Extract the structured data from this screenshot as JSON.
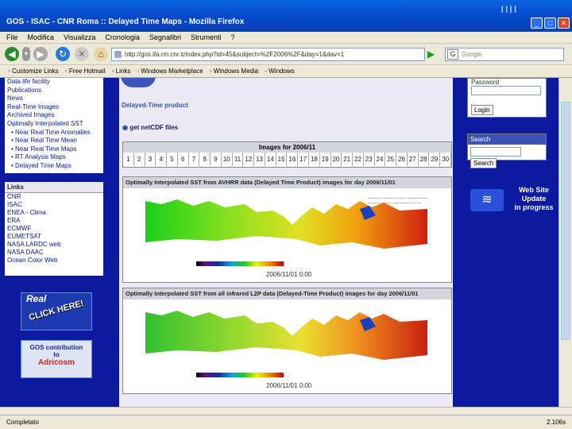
{
  "window": {
    "title": "GOS - ISAC - CNR Roma :: Delayed Time Maps - Mozilla Firefox",
    "deco": "ıııı"
  },
  "menu": [
    "File",
    "Modifica",
    "Visualizza",
    "Cronologia",
    "Segnalibri",
    "Strumenti",
    "?"
  ],
  "address": {
    "url": "http://gos.ifa.rm.cnr.it/index.php?id=45&subject=%2F2006%2F&day=1&dav=1"
  },
  "search": {
    "placeholder": "Google",
    "engine_letter": "G"
  },
  "bookmarks": [
    "Customize Links",
    "Free Hotmail",
    "Links",
    "Windows Marketplace",
    "Windows Media",
    "Windows"
  ],
  "left_nav": {
    "items": [
      "Data life facility",
      "Publications",
      "News",
      "Real-Time Images",
      "Archived Images",
      "Optimally Interpolated SST"
    ],
    "sub_items": [
      "Near Real Time Anomalies",
      "Near Real Time Mean",
      "Near Real Time Maps",
      "RT Analysis Maps",
      "Delayed Time Maps"
    ]
  },
  "links": {
    "header": "Links",
    "items": [
      "CNR",
      "ISAC",
      "ENEA - Clima",
      "ERA",
      "ECMWF",
      "EUMETSAT",
      "NASA LARDC web",
      "NASA DAAC",
      "Ocean Color Web"
    ]
  },
  "banners": {
    "real_images": "CLICK HERE!",
    "real_images_top": "Real",
    "gos_contrib_1": "GOS contribution",
    "gos_contrib_2": "to",
    "gos_contrib_3": "Adricosm"
  },
  "main": {
    "product": "Delayed-Time product",
    "netcdf": "get netCDF files",
    "days_header": "Images for 2006/11",
    "days": [
      "1",
      "2",
      "3",
      "4",
      "5",
      "6",
      "7",
      "8",
      "9",
      "10",
      "11",
      "12",
      "13",
      "14",
      "15",
      "16",
      "17",
      "18",
      "19",
      "20",
      "21",
      "22",
      "23",
      "24",
      "25",
      "26",
      "27",
      "28",
      "29",
      "30"
    ],
    "panel1_title": "Optimally Interpolated SST from AVHRR data (Delayed Time Product) images for day 2006/11/01",
    "panel1_date": "2006/11/01 0:00",
    "panel2_title": "Optimally Interpolated SST from all infrared L2P data (Delayed-Time Product) images for day 2006/11/01",
    "panel2_date": "2006/11/01 0:00"
  },
  "right": {
    "password_label": "Password",
    "login": "Login",
    "search_label": "Search",
    "search_btn": "Search",
    "update_1": "Web Site",
    "update_2": "Update",
    "update_3": "in progress"
  },
  "status": {
    "text": "Completato",
    "right": "2.106s"
  },
  "colors": {
    "page_bg": "#0b1a9e",
    "title_bar": "#0a5ae0",
    "chrome": "#ece9d8"
  }
}
